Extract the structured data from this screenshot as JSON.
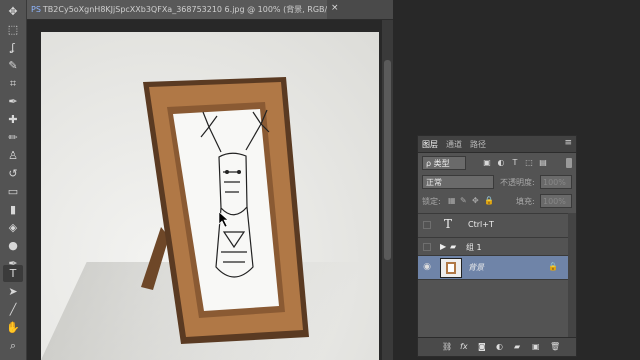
{
  "document": {
    "tab_title": "TB2Cy5oXgnH8KJjSpcXXb3QFXa_368753210 6.jpg @ 100% (背景, RGB/8) *",
    "ps_badge": "PS",
    "close_glyph": "×"
  },
  "tools": [
    {
      "name": "move-tool",
      "glyph": "✥"
    },
    {
      "name": "marquee-tool",
      "glyph": "⬚"
    },
    {
      "name": "lasso-tool",
      "glyph": "ʆ"
    },
    {
      "name": "quick-select-tool",
      "glyph": "✎"
    },
    {
      "name": "crop-tool",
      "glyph": "⌗"
    },
    {
      "name": "eyedropper-tool",
      "glyph": "✒"
    },
    {
      "name": "healing-brush-tool",
      "glyph": "✚"
    },
    {
      "name": "brush-tool",
      "glyph": "✏"
    },
    {
      "name": "clone-stamp-tool",
      "glyph": "♙"
    },
    {
      "name": "history-brush-tool",
      "glyph": "↺"
    },
    {
      "name": "eraser-tool",
      "glyph": "▭"
    },
    {
      "name": "gradient-tool",
      "glyph": "▮"
    },
    {
      "name": "blur-tool",
      "glyph": "💧"
    },
    {
      "name": "dodge-tool",
      "glyph": "●"
    },
    {
      "name": "pen-tool",
      "glyph": "✒"
    },
    {
      "name": "type-tool",
      "glyph": "T"
    },
    {
      "name": "path-select-tool",
      "glyph": "➤"
    },
    {
      "name": "line-tool",
      "glyph": "╱"
    },
    {
      "name": "hand-tool",
      "glyph": "✋"
    },
    {
      "name": "zoom-tool",
      "glyph": "🔍"
    },
    {
      "name": "more-tools",
      "glyph": "…"
    }
  ],
  "layers_panel": {
    "tabs": [
      "图层",
      "通道",
      "路径"
    ],
    "menu_glyph": "≡",
    "kind_select": "ρ 类型",
    "blend_mode": "正常",
    "opacity_label": "不透明度:",
    "opacity_value": "100%",
    "lock_label": "锁定:",
    "fill_label": "填充:",
    "fill_value": "100%",
    "layers": [
      {
        "name": "Ctrl+T",
        "type": "text",
        "visible": false,
        "selected": false
      },
      {
        "name": "组 1",
        "type": "group",
        "visible": false,
        "selected": false
      },
      {
        "name": "背景",
        "type": "image",
        "visible": true,
        "selected": true,
        "locked": true
      }
    ]
  },
  "colors": {
    "selected_layer": "#6f84a8",
    "frame_wood": "#b07846"
  }
}
